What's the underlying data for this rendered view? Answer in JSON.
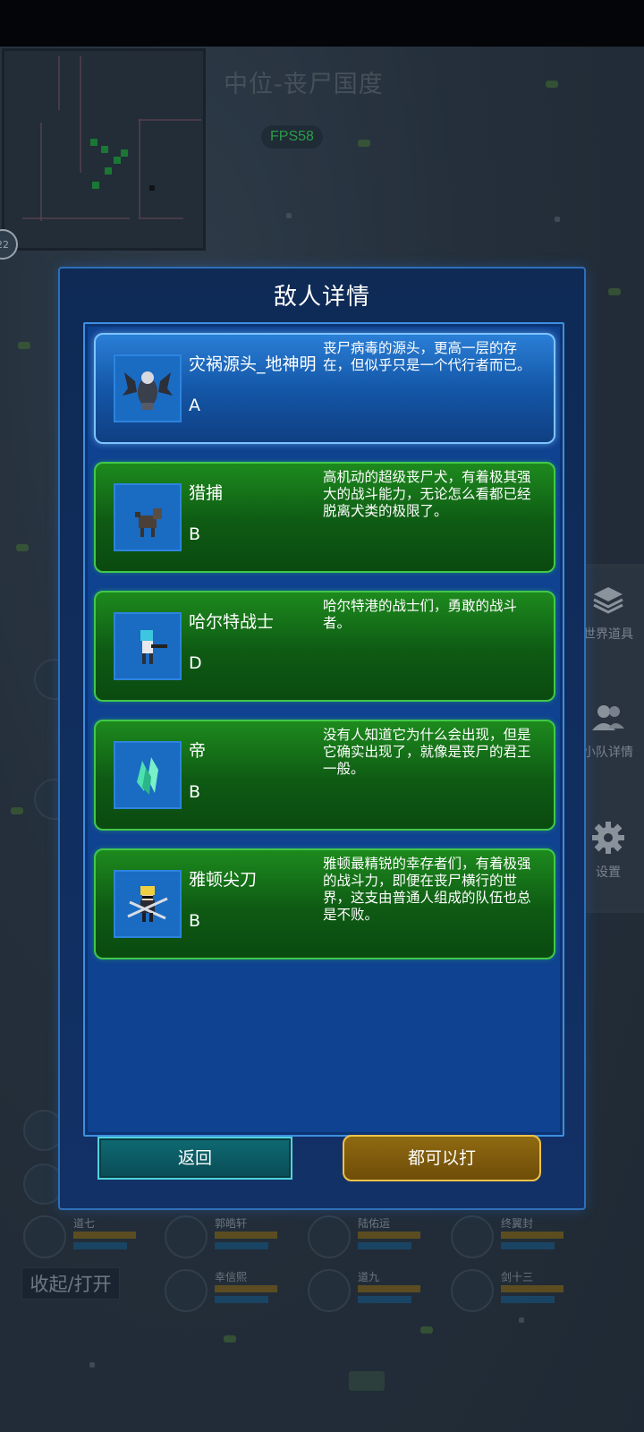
{
  "map": {
    "title": "中位-丧尸国度",
    "fps": "FPS58",
    "minimap_badge": "22"
  },
  "side_menu": [
    {
      "label": "世界道具",
      "icon": "layers-icon"
    },
    {
      "label": "小队详情",
      "icon": "group-icon"
    },
    {
      "label": "设置",
      "icon": "gear-icon"
    }
  ],
  "party": [
    {
      "name": "道七"
    },
    {
      "name": "郭皓轩"
    },
    {
      "name": "陆佑运"
    },
    {
      "name": "终翼封"
    },
    {
      "name": "幸信熙"
    },
    {
      "name": "道九"
    },
    {
      "name": "剑十三"
    }
  ],
  "collapse_label": "收起/打开",
  "dialog": {
    "title": "敌人详情",
    "enemies": [
      {
        "name": "灾祸源头_地神明",
        "rank": "A",
        "desc": "丧尸病毒的源头，更高一层的存在，但似乎只是一个代行者而已。",
        "selected": true,
        "sprite": "winged-demon-sprite"
      },
      {
        "name": "猎捕",
        "rank": "B",
        "desc": "高机动的超级丧尸犬，有着极其强大的战斗能力，无论怎么看都已经脱离犬类的极限了。",
        "selected": false,
        "sprite": "zombie-dog-sprite"
      },
      {
        "name": "哈尔特战士",
        "rank": "D",
        "desc": "哈尔特港的战士们，勇敢的战斗者。",
        "selected": false,
        "sprite": "gunner-sprite"
      },
      {
        "name": "帝",
        "rank": "B",
        "desc": "没有人知道它为什么会出现，但是它确实出现了，就像是丧尸的君王一般。",
        "selected": false,
        "sprite": "crystal-sprite"
      },
      {
        "name": "雅顿尖刀",
        "rank": "B",
        "desc": "雅顿最精锐的幸存者们，有着极强的战斗力，即便在丧尸横行的世界，这支由普通人组成的队伍也总是不败。",
        "selected": false,
        "sprite": "blade-squad-sprite"
      }
    ],
    "back_label": "返回",
    "fight_label": "都可以打"
  },
  "colors": {
    "card_green": "#0e5a14",
    "card_blue": "#1457a8",
    "panel_blue": "#0f4290",
    "fps_green": "#37c95a",
    "gold_border": "#f0c24a",
    "teal_border": "#4fd2dc"
  }
}
